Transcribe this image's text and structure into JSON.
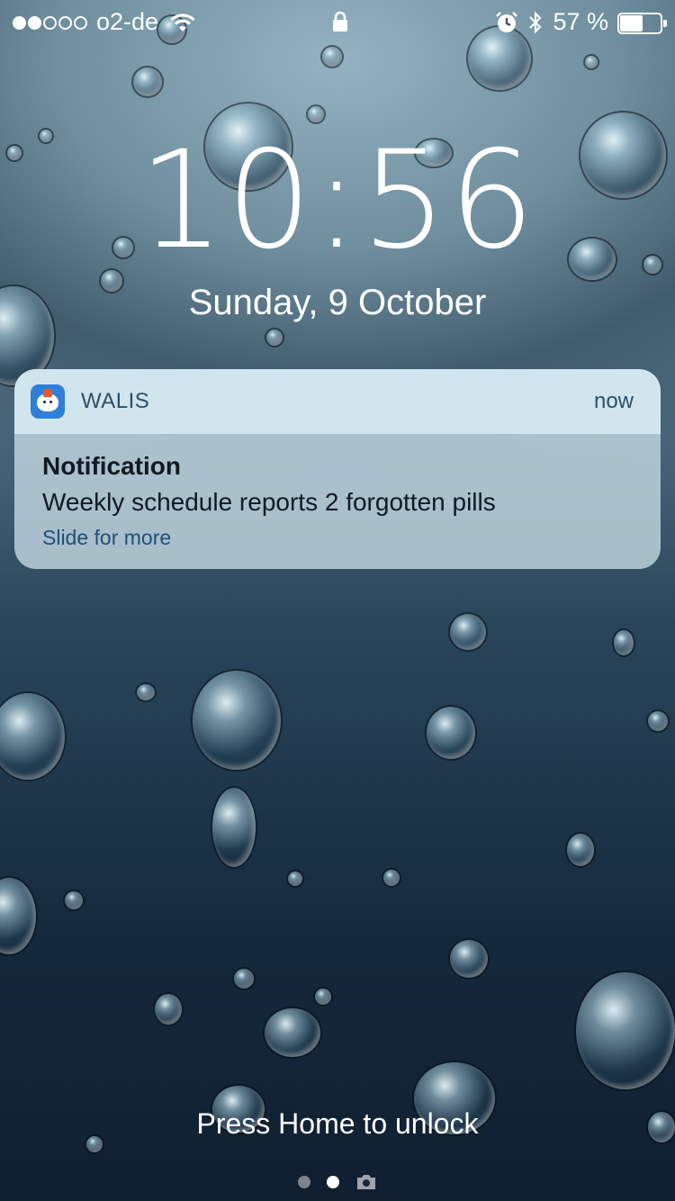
{
  "status_bar": {
    "signal_bars_filled": 2,
    "signal_bars_total": 5,
    "carrier": "o2-de",
    "battery_percent_label": "57 %",
    "battery_level": 0.57
  },
  "lock_screen": {
    "time": "10:56",
    "date": "Sunday, 9 October",
    "unlock_hint": "Press Home to unlock",
    "page_indicator": {
      "count": 2,
      "active_index": 1,
      "has_camera": true
    }
  },
  "notification": {
    "app_name": "WALIS",
    "time": "now",
    "title": "Notification",
    "body": "Weekly schedule reports 2 forgotten pills",
    "action_hint": "Slide for more"
  },
  "icons": {
    "wifi": "wifi-icon",
    "lock": "lock-icon",
    "alarm": "alarm-icon",
    "bluetooth": "bluetooth-icon",
    "battery": "battery-icon",
    "camera": "camera-icon",
    "app": "walis-app-icon"
  },
  "colors": {
    "notification_header": "#d7ebf3",
    "notification_body": "#c8dce6",
    "app_icon_bg": "#2f7fd9",
    "link_text": "#1e4f78"
  }
}
